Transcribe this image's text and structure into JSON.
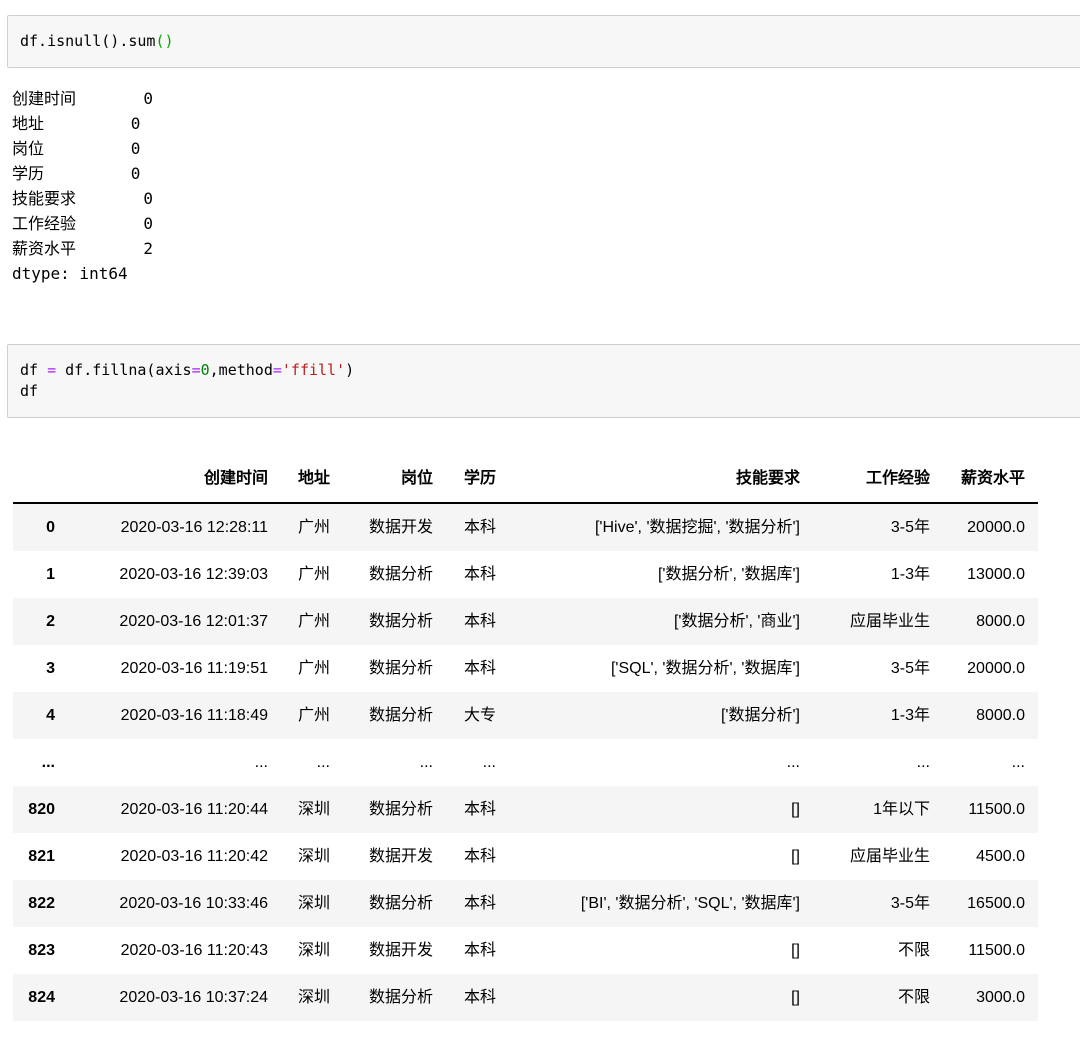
{
  "notebook": {
    "cell1": {
      "code_main": "df.isnull().sum",
      "code_matching_brackets": "()"
    },
    "series_output": {
      "text": "创建时间       0\n地址         0\n岗位         0\n学历         0\n技能要求       0\n工作经验       0\n薪资水平       2\ndtype: int64"
    },
    "cell2": {
      "t1": "df ",
      "op1": "=",
      "t2": " df.fillna(axis",
      "op2": "=",
      "num": "0",
      "t3": ",method",
      "op3": "=",
      "str": "'ffill'",
      "t4": ")",
      "line2": "df"
    },
    "colors": {
      "operator": "#AA22FF",
      "number": "#008000",
      "string": "#BA2121",
      "matching_bracket": "#00AA00",
      "cell_background": "#f7f7f7",
      "cell_border": "#cfcfcf",
      "row_stripe": "#f5f5f5"
    }
  },
  "table": {
    "headers": [
      "",
      "创建时间",
      "地址",
      "岗位",
      "学历",
      "技能要求",
      "工作经验",
      "薪资水平"
    ],
    "rows": [
      [
        "0",
        "2020-03-16 12:28:11",
        "广州",
        "数据开发",
        "本科",
        "['Hive', '数据挖掘', '数据分析']",
        "3-5年",
        "20000.0"
      ],
      [
        "1",
        "2020-03-16 12:39:03",
        "广州",
        "数据分析",
        "本科",
        "['数据分析', '数据库']",
        "1-3年",
        "13000.0"
      ],
      [
        "2",
        "2020-03-16 12:01:37",
        "广州",
        "数据分析",
        "本科",
        "['数据分析', '商业']",
        "应届毕业生",
        "8000.0"
      ],
      [
        "3",
        "2020-03-16 11:19:51",
        "广州",
        "数据分析",
        "本科",
        "['SQL', '数据分析', '数据库']",
        "3-5年",
        "20000.0"
      ],
      [
        "4",
        "2020-03-16 11:18:49",
        "广州",
        "数据分析",
        "大专",
        "['数据分析']",
        "1-3年",
        "8000.0"
      ],
      [
        "...",
        "...",
        "...",
        "...",
        "...",
        "...",
        "...",
        "..."
      ],
      [
        "820",
        "2020-03-16 11:20:44",
        "深圳",
        "数据分析",
        "本科",
        "[]",
        "1年以下",
        "11500.0"
      ],
      [
        "821",
        "2020-03-16 11:20:42",
        "深圳",
        "数据开发",
        "本科",
        "[]",
        "应届毕业生",
        "4500.0"
      ],
      [
        "822",
        "2020-03-16 10:33:46",
        "深圳",
        "数据分析",
        "本科",
        "['BI', '数据分析', 'SQL', '数据库']",
        "3-5年",
        "16500.0"
      ],
      [
        "823",
        "2020-03-16 11:20:43",
        "深圳",
        "数据开发",
        "本科",
        "[]",
        "不限",
        "11500.0"
      ],
      [
        "824",
        "2020-03-16 10:37:24",
        "深圳",
        "数据分析",
        "本科",
        "[]",
        "不限",
        "3000.0"
      ]
    ]
  }
}
